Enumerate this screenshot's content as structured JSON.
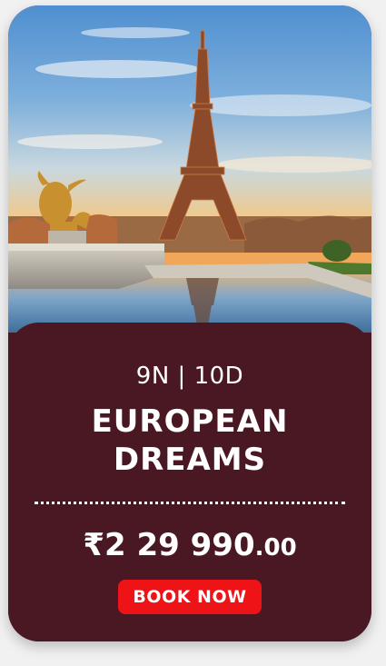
{
  "package": {
    "duration": "9N | 10D",
    "title_line1": "EUROPEAN",
    "title_line2": "DREAMS",
    "currency_symbol": "₹",
    "price_main": "2 29 990",
    "price_decimal": ".00",
    "cta_label": "BOOK NOW"
  },
  "image": {
    "subject": "eiffel-tower-photo"
  },
  "colors": {
    "panel": "#4a1822",
    "button": "#ee1316",
    "text": "#ffffff",
    "page_bg": "#f1f1f1"
  }
}
